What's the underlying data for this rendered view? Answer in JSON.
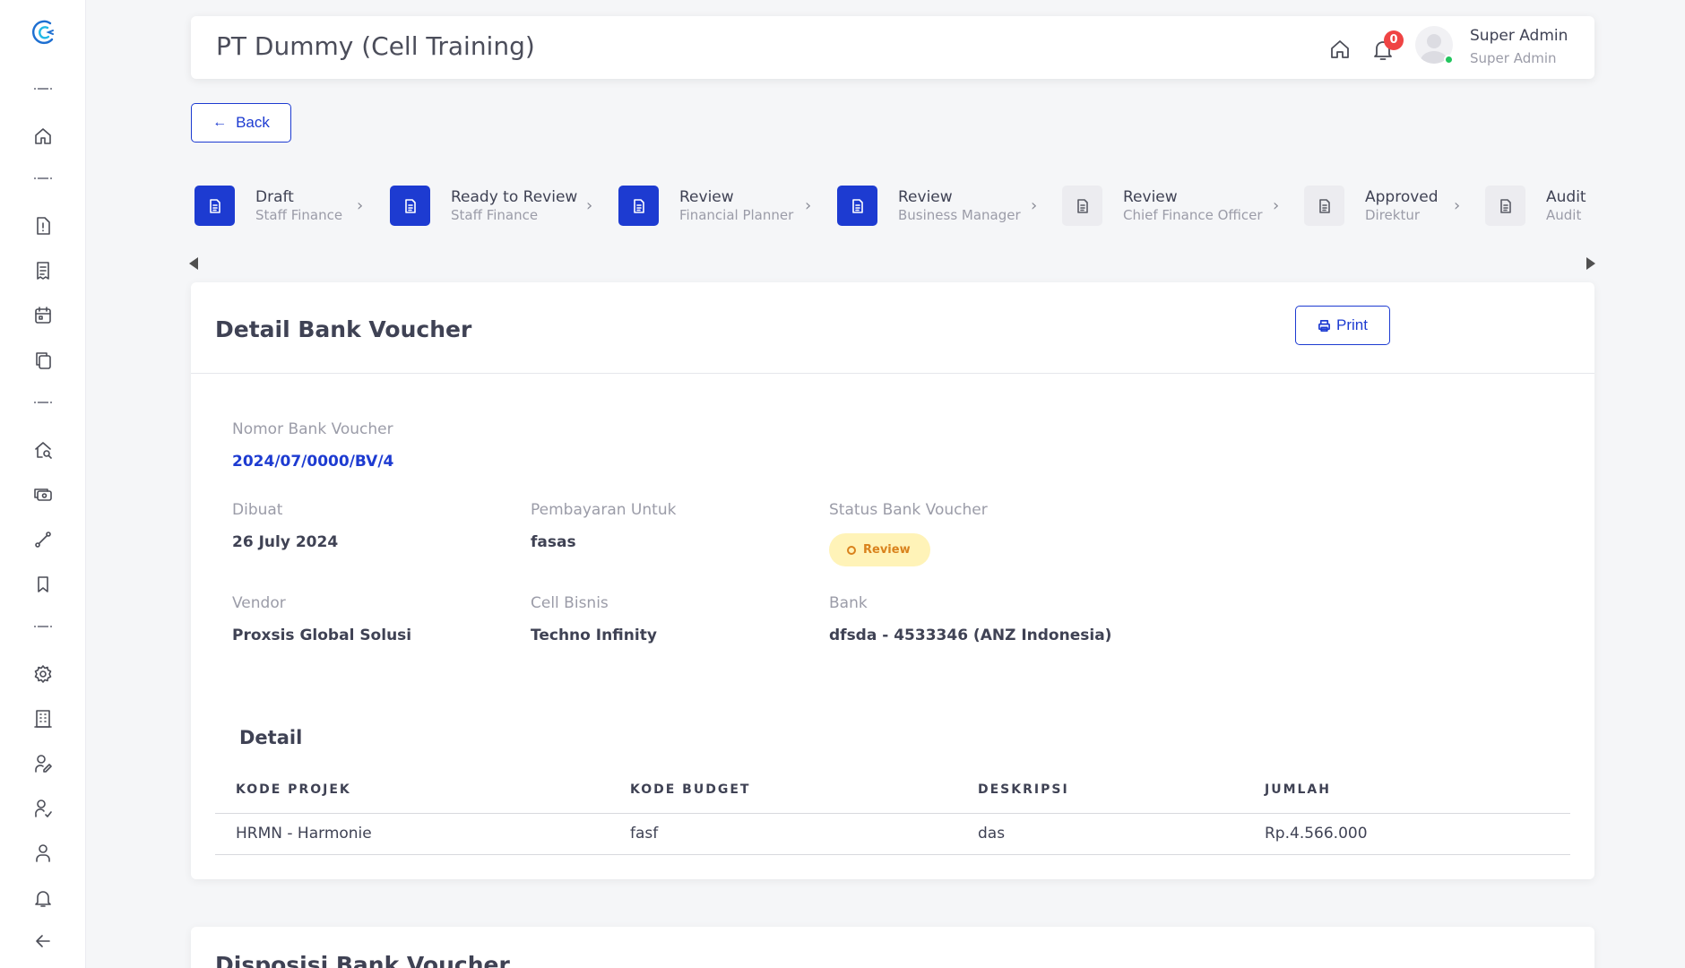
{
  "header": {
    "title": "PT Dummy (Cell Training)",
    "notifications_count": "0",
    "user_name": "Super Admin",
    "user_role": "Super Admin"
  },
  "back_label": "Back",
  "stepper": [
    {
      "title": "Draft",
      "subtitle": "Staff Finance",
      "state": "active"
    },
    {
      "title": "Ready to Review",
      "subtitle": "Staff Finance",
      "state": "active"
    },
    {
      "title": "Review",
      "subtitle": "Financial Planner",
      "state": "active"
    },
    {
      "title": "Review",
      "subtitle": "Business Manager",
      "state": "active"
    },
    {
      "title": "Review",
      "subtitle": "Chief Finance Officer",
      "state": "inactive"
    },
    {
      "title": "Approved",
      "subtitle": "Direktur",
      "state": "inactive"
    },
    {
      "title": "Audit",
      "subtitle": "Audit",
      "state": "inactive"
    }
  ],
  "detail_card": {
    "title": "Detail Bank Voucher",
    "print_label": "Print",
    "fields": {
      "nomor_label": "Nomor Bank Voucher",
      "nomor_value": "2024/07/0000/BV/4",
      "dibuat_label": "Dibuat",
      "dibuat_value": "26 July 2024",
      "pembayaran_label": "Pembayaran Untuk",
      "pembayaran_value": "fasas",
      "status_label": "Status Bank Voucher",
      "status_value": "Review",
      "vendor_label": "Vendor",
      "vendor_value": "Proxsis Global Solusi",
      "cell_label": "Cell Bisnis",
      "cell_value": "Techno Infinity",
      "bank_label": "Bank",
      "bank_value": "dfsda - 4533346 (ANZ Indonesia)"
    },
    "detail_title": "Detail",
    "table": {
      "columns": [
        "KODE PROJEK",
        "KODE BUDGET",
        "DESKRIPSI",
        "JUMLAH"
      ],
      "rows": [
        [
          "HRMN - Harmonie",
          "fasf",
          "das",
          "Rp.4.566.000"
        ]
      ]
    }
  },
  "disposisi_card": {
    "title": "Disposisi Bank Voucher"
  },
  "colors": {
    "primary": "#1d3bd1",
    "badge_bg": "#fff3b8",
    "badge_text": "#d9821c",
    "notification": "#ef4444",
    "online": "#22c55e"
  },
  "icons": {
    "sidebar": [
      "app-logo",
      "home-icon",
      "report-alert-icon",
      "receipt-icon",
      "calendar-icon",
      "copy-icon",
      "building-search-icon",
      "cash-icon",
      "route-icon",
      "bookmark-icon",
      "settings-icon",
      "office-building-icon",
      "user-edit-icon",
      "user-check-icon",
      "user-icon",
      "bell-icon",
      "arrow-left-icon"
    ]
  }
}
